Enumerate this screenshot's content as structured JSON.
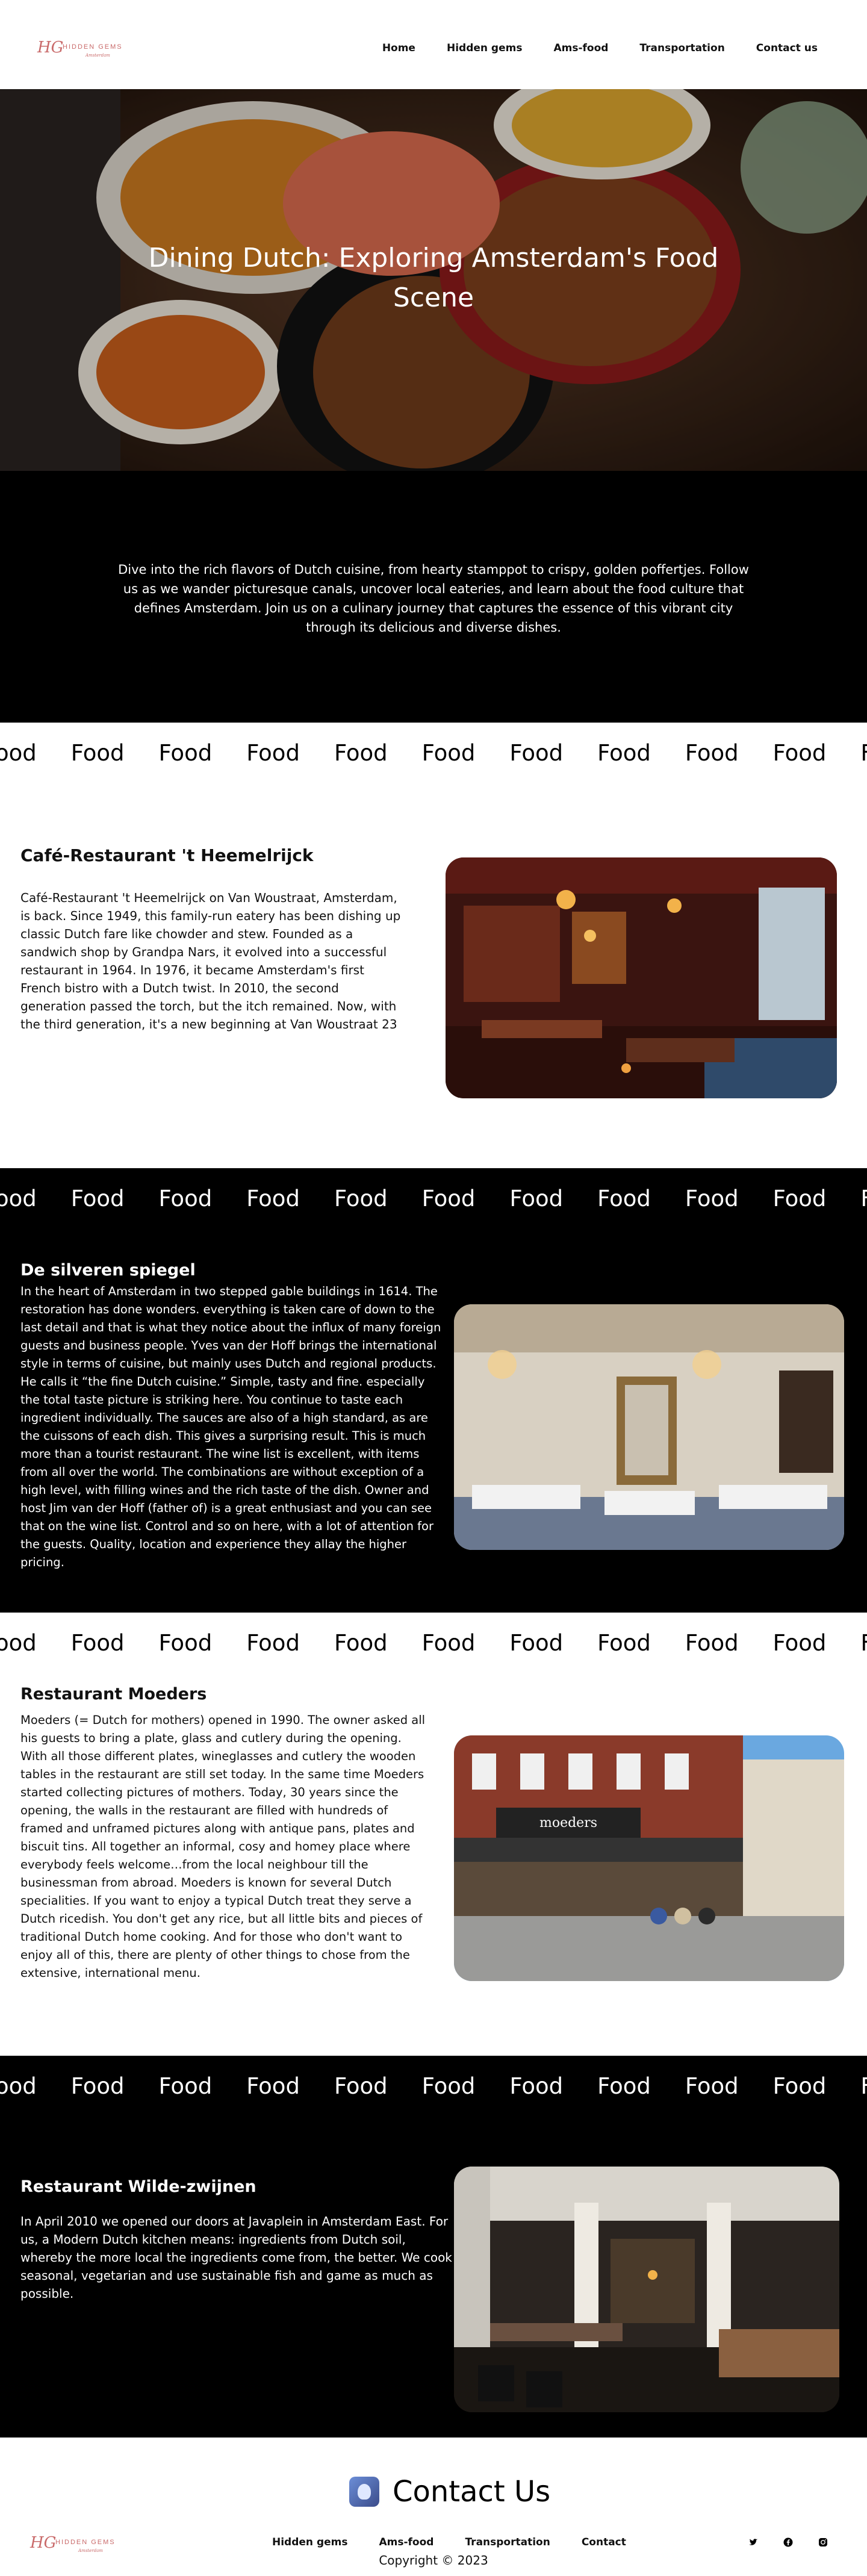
{
  "header": {
    "logo_text": "HIDDEN GEMS",
    "logo_sub": "Amsterdam",
    "nav": [
      "Home",
      "Hidden gems",
      "Ams-food",
      "Transportation",
      "Contact us"
    ]
  },
  "hero": {
    "title": "Dining Dutch: Exploring Amsterdam's Food Scene"
  },
  "intro": {
    "text": "Dive into the rich flavors of Dutch cuisine, from hearty stamppot to crispy, golden poffertjes. Follow us as we wander picturesque canals, uncover local eateries, and learn about the food culture that defines Amsterdam. Join us on a culinary journey that captures the essence of this vibrant city through its delicious and diverse dishes."
  },
  "marquee": {
    "word": "Food"
  },
  "sections": [
    {
      "title": "Café-Restaurant 't Heemelrijck",
      "body": "Café-Restaurant 't Heemelrijck on Van Woustraat, Amsterdam, is back. Since 1949, this family-run eatery has been dishing up classic Dutch fare like chowder and stew. Founded as a sandwich shop by Grandpa Nars, it evolved into a successful restaurant in 1964. In 1976, it became Amsterdam's first French bistro with a Dutch twist. In 2010, the second generation passed the torch, but the itch remained. Now, with the third generation, it's a new beginning at Van Woustraat 23"
    },
    {
      "title": "De silveren spiegel",
      "body": "In the heart of Amsterdam in two stepped gable buildings in 1614. The restoration has done wonders. everything is taken care of down to the last detail and that is what they notice about the influx of many foreign guests and business people. Yves van der Hoff brings the international style in terms of cuisine, but mainly uses Dutch and regional products. He calls it “the fine Dutch cuisine.” Simple, tasty and fine. especially the total taste picture is striking here. You continue to taste each ingredient individually. The sauces are also of a high standard, as are the cuissons of each dish. This gives a surprising result. This is much more than a tourist restaurant. The wine list is excellent, with items from all over the world. The combinations are without exception of a high level, with filling wines and the rich taste of the dish. Owner and host Jim van der Hoff (father of) is a great enthusiast and you can see that on the wine list. Control and so on here, with a lot of attention for the guests. Quality, location and experience they allay the higher pricing."
    },
    {
      "title": "Restaurant Moeders",
      "body": "Moeders (= Dutch for mothers) opened in 1990. The owner asked all his guests to bring a plate, glass and cutlery during the opening. With all those different plates, wineglasses and cutlery the wooden tables in the restaurant are still set today. In the same time Moeders started collecting pictures of mothers. Today, 30 years since the opening, the walls in the restaurant are filled with hundreds of framed and unframed pictures along with antique pans, plates and biscuit tins. All together an informal, cosy and homey place where everybody feels welcome…from the local neighbour till the businessman from abroad. Moeders is known for several Dutch specialities. If you want to enjoy a typical Dutch treat they serve a Dutch ricedish. You don't get any rice, but all little bits and pieces of traditional Dutch home cooking. And for those who don't want to enjoy all of this, there are plenty of other things to chose from the extensive, international menu."
    },
    {
      "title": "Restaurant Wilde-zwijnen",
      "body": "In April 2010 we opened our doors at Javaplein in Amsterdam East. For us, a Modern Dutch kitchen means: ingredients from Dutch soil, whereby the more local the ingredients come from, the better. We cook seasonal, vegetarian and use sustainable fish and game as much as possible."
    }
  ],
  "images": {
    "moeders_sign": "moeders"
  },
  "footer": {
    "contact_title": "Contact Us",
    "nav": [
      "Hidden gems",
      "Ams-food",
      "Transportation",
      "Contact"
    ],
    "social": [
      "twitter-icon",
      "facebook-icon",
      "instagram-icon"
    ],
    "copyright": "Copyright © 2023"
  },
  "colors": {
    "brand": "#c96a6a",
    "dark_band": "#000000"
  }
}
